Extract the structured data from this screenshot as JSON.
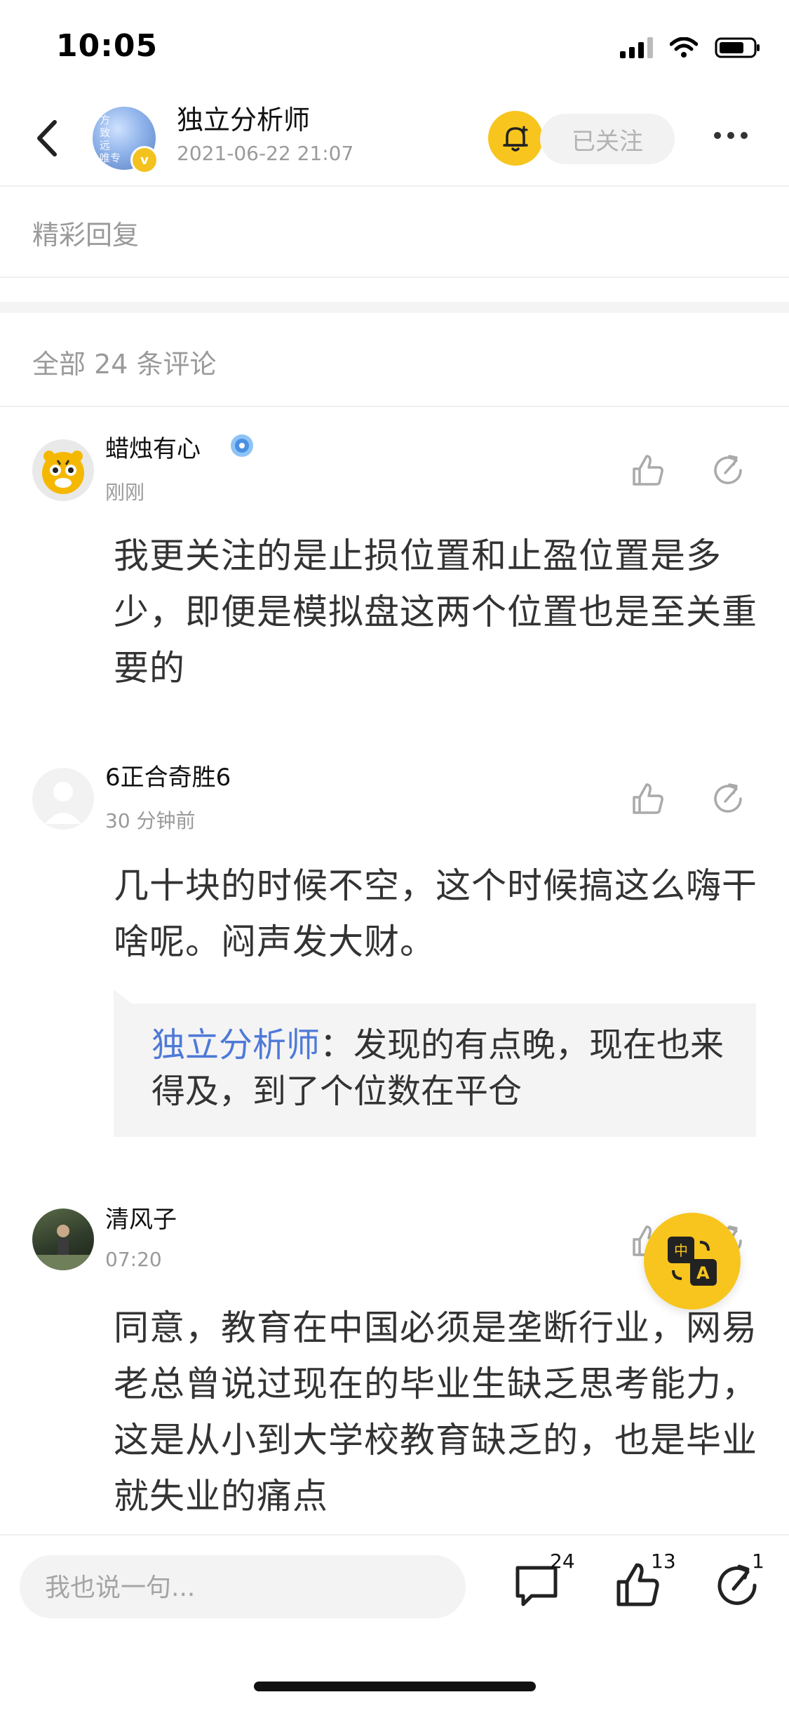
{
  "status_bar": {
    "time": "10:05"
  },
  "header": {
    "author_name": "独立分析师",
    "post_date": "2021-06-22 21:07",
    "follow_label": "已关注",
    "avatar_text": "方\n致\n远\n唯专"
  },
  "sections": {
    "featured_title": "精彩回复",
    "all_comments_title": "全部 24 条评论"
  },
  "comments": [
    {
      "name": "蜡烛有心",
      "time": "刚刚",
      "body": "我更关注的是止损位置和止盈位置是多少，即便是模拟盘这两个位置也是至关重要的"
    },
    {
      "name": "6正合奇胜6",
      "time": "30 分钟前",
      "body": "几十块的时候不空，这个时候搞这么嗨干啥呢。闷声发大财。",
      "reply": {
        "author": "独立分析师",
        "separator": "：",
        "text": "发现的有点晚，现在也来得及，到了个位数在平仓"
      }
    },
    {
      "name": "清风子",
      "time": "07:20",
      "body": "同意，教育在中国必须是垄断行业，网易老总曾说过现在的毕业生缺乏思考能力，这是从小到大学校教育缺乏的，也是毕业就失业的痛点"
    }
  ],
  "bottom_bar": {
    "input_placeholder": "我也说一句...",
    "comment_count": "24",
    "like_count": "13",
    "share_count": "1"
  },
  "colors": {
    "accent_yellow": "#f7c51e",
    "reply_author_blue": "#4e79d8",
    "muted_gray": "#9a9a9a"
  }
}
